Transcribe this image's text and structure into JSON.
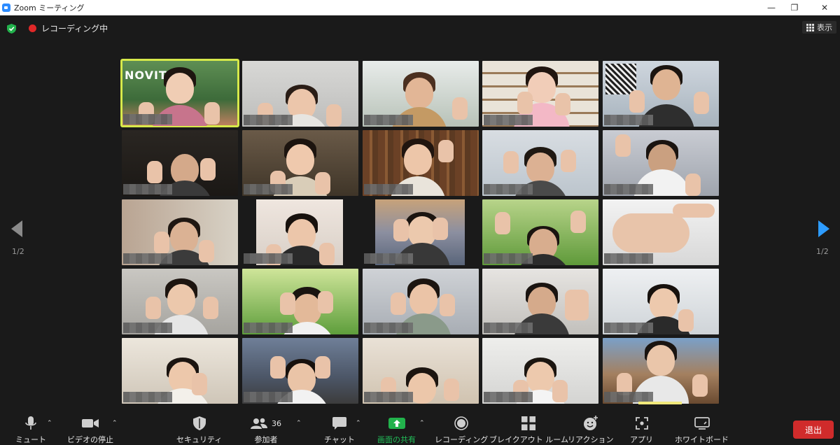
{
  "window": {
    "title": "Zoom ミーティング",
    "minimize": "—",
    "maximize": "❐",
    "close": "✕"
  },
  "topbar": {
    "recording_label": "レコーディング中",
    "view_label": "表示"
  },
  "navigation": {
    "page_left": "1/2",
    "page_right": "1/2"
  },
  "participants_count": "36",
  "toolbar": {
    "mute": "ミュート",
    "stop_video": "ビデオの停止",
    "security": "セキュリティ",
    "participants": "参加者",
    "chat": "チャット",
    "share_screen": "画面の共有",
    "record": "レコーディング",
    "breakout": "ブレイクアウト ルーム",
    "reactions": "リアクション",
    "apps": "アプリ",
    "whiteboard": "ホワイトボード",
    "leave": "退出"
  },
  "tile_overlay_text": {
    "novita": "NOVITA"
  },
  "colors": {
    "accent_green": "#22b24c",
    "active_speaker": "#d6e94a",
    "leave_red": "#d02b2b",
    "nav_blue": "#2d9cff"
  }
}
